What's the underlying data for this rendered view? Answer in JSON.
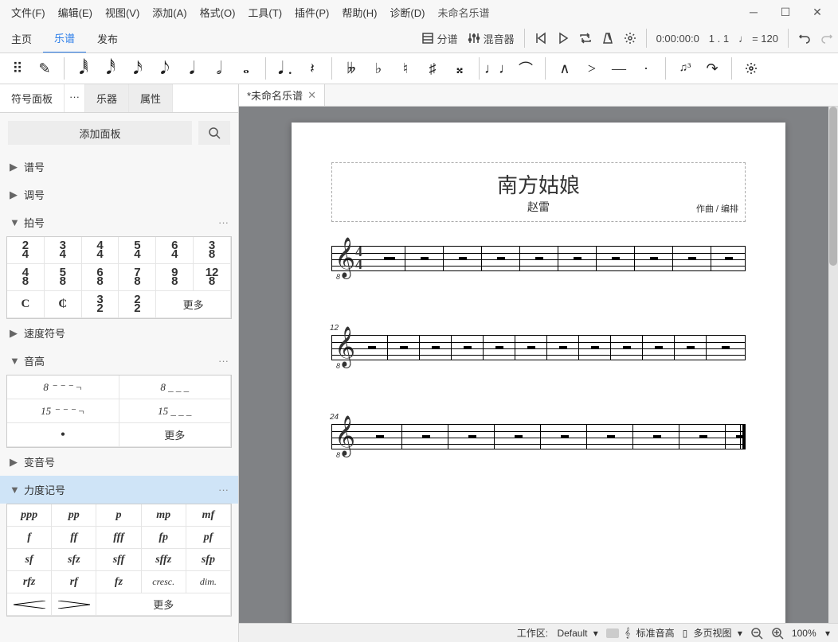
{
  "menu": [
    "文件(F)",
    "编辑(E)",
    "视图(V)",
    "添加(A)",
    "格式(O)",
    "工具(T)",
    "插件(P)",
    "帮助(H)",
    "诊断(D)"
  ],
  "docTitle": "未命名乐谱",
  "mainTabs": {
    "home": "主页",
    "score": "乐谱",
    "publish": "发布"
  },
  "transport": {
    "parts": "分谱",
    "mixer": "混音器",
    "time": "0:00:00:0",
    "beat": "1 . 1",
    "tempo": "= 120"
  },
  "leftTabs": {
    "palette": "符号面板",
    "ellipsis": "···",
    "instruments": "乐器",
    "properties": "属性"
  },
  "addPanel": "添加面板",
  "sections": {
    "clef": "谱号",
    "key": "调号",
    "time": "拍号",
    "tempo": "速度符号",
    "pitch": "音高",
    "acc": "变音号",
    "dyn": "力度记号"
  },
  "more": "更多",
  "timesigs": [
    "2/4",
    "3/4",
    "4/4",
    "5/4",
    "6/4",
    "3/8",
    "4/8",
    "5/8",
    "6/8",
    "7/8",
    "9/8",
    "12/8",
    "C",
    "₵",
    "3/2",
    "2/2"
  ],
  "pitch": [
    "8 ⁻ ⁻ ⁻ ¬",
    "8 _ _ _",
    "15 ⁻ ⁻ ⁻ ¬",
    "15 _ _ _",
    "•"
  ],
  "dynamics": [
    "ppp",
    "pp",
    "p",
    "mp",
    "mf",
    "f",
    "ff",
    "fff",
    "fp",
    "pf",
    "sf",
    "sfz",
    "sff",
    "sffz",
    "sfp",
    "rfz",
    "rf",
    "fz",
    "cresc.",
    "dim."
  ],
  "hair": [
    "<",
    ">"
  ],
  "docTab": "*未命名乐谱",
  "score": {
    "title": "南方姑娘",
    "subtitle": "赵雷",
    "composer": "作曲 / 编排",
    "m12": "12",
    "m24": "24",
    "timesig": "4\n4"
  },
  "status": {
    "workspace": "工作区:",
    "wsDefault": "Default",
    "concert": "标准音高",
    "multiview": "多页视图",
    "zoom": "100%",
    "zoomDrop": "▾"
  }
}
